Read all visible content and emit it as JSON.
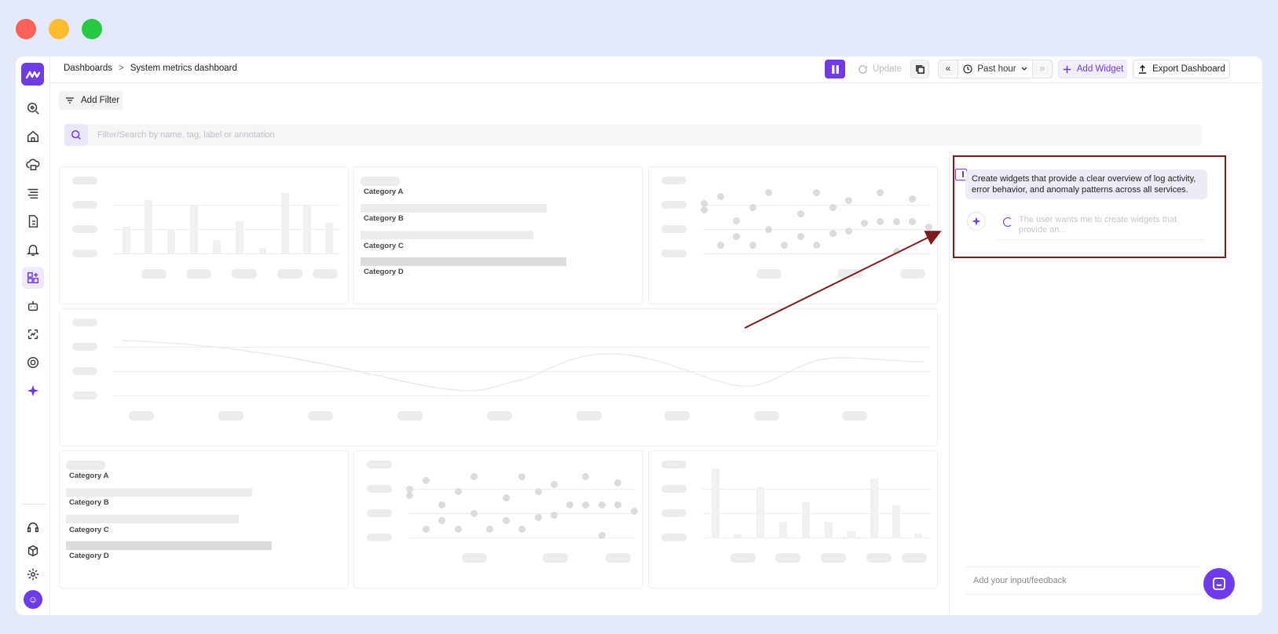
{
  "window": {
    "controls": [
      "close",
      "minimize",
      "maximize"
    ]
  },
  "sidebar": {
    "logo_text": "M",
    "items": [
      {
        "name": "explore-icon"
      },
      {
        "name": "home-icon"
      },
      {
        "name": "infra-icon"
      },
      {
        "name": "logs-icon"
      },
      {
        "name": "reports-icon"
      },
      {
        "name": "alerts-icon"
      },
      {
        "name": "dashboards-icon",
        "active": true
      },
      {
        "name": "bot-icon"
      },
      {
        "name": "apm-icon"
      },
      {
        "name": "settings-gear-icon"
      },
      {
        "name": "ai-sparkle-icon"
      }
    ],
    "bottom": [
      {
        "name": "support-icon"
      },
      {
        "name": "integrations-icon"
      },
      {
        "name": "settings-icon"
      }
    ],
    "avatar_text": "☺"
  },
  "breadcrumb": {
    "root": "Dashboards",
    "separator": ">",
    "current": "System metrics dashboard"
  },
  "toolbar": {
    "update_label": "Update",
    "time_range": "Past hour",
    "prev": "«",
    "next": "»",
    "add_widget_label": "Add Widget",
    "export_label": "Export Dashboard"
  },
  "filter": {
    "add_filter_label": "Add Filter",
    "search_placeholder": "Filter/Search by name, tag, label or annotation"
  },
  "categories": [
    "Category A",
    "Category B",
    "Category C",
    "Category D"
  ],
  "ai_panel": {
    "user_message": "Create widgets that provide a clear overview of log activity, error behavior, and anomaly patterns across all services.",
    "thinking_text": "The user wants me to create widgets that provide an...",
    "feedback_placeholder": "Add your input/feedback"
  },
  "colors": {
    "accent": "#6f3be8",
    "highlight": "#7a1c1c"
  }
}
